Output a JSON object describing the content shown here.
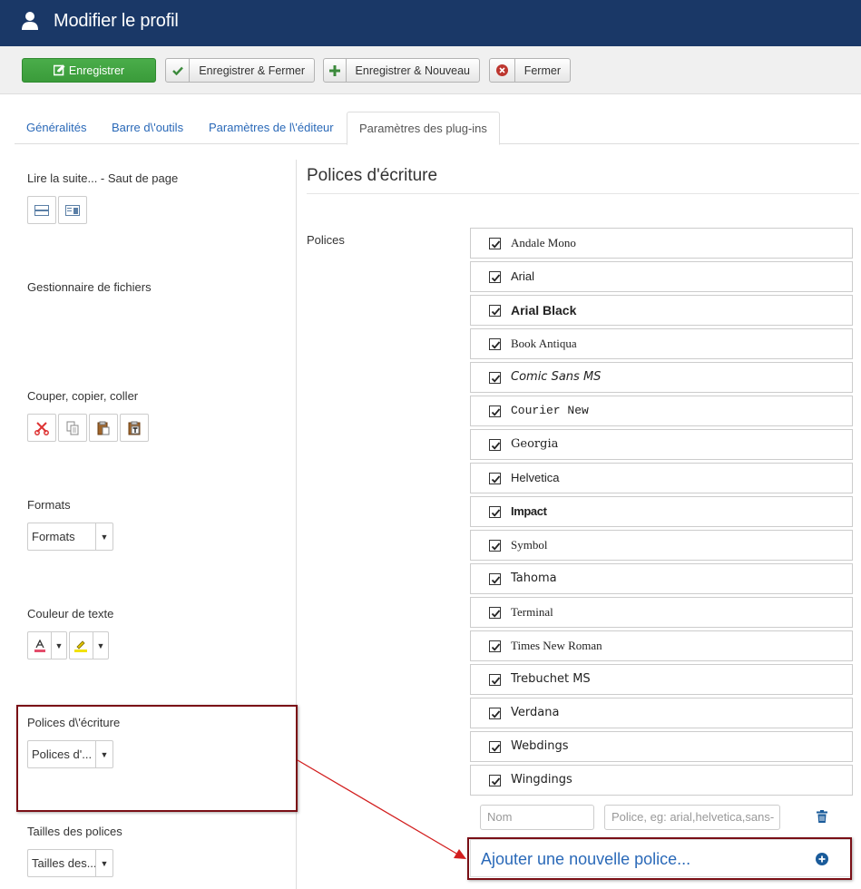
{
  "header": {
    "title": "Modifier le profil",
    "icon": "user-icon"
  },
  "toolbar": {
    "save": "Enregistrer",
    "save_close": "Enregistrer & Fermer",
    "save_new": "Enregistrer & Nouveau",
    "close": "Fermer",
    "colors": {
      "primary": "#3fa43f",
      "check": "#3c8a3c",
      "plus": "#3c8a3c",
      "close": "#bd362f"
    }
  },
  "tabs": [
    {
      "label": "Généralités",
      "active": false
    },
    {
      "label": "Barre d\\'outils",
      "active": false
    },
    {
      "label": "Paramètres de l\\'éditeur",
      "active": false
    },
    {
      "label": "Paramètres des plug-ins",
      "active": true
    }
  ],
  "left": {
    "pagebreak_label": "Lire la suite... - Saut de page",
    "filemanager_label": "Gestionnaire de fichiers",
    "clipboard_label": "Couper, copier, coller",
    "formats_label": "Formats",
    "formats_value": "Formats",
    "textcolor_label": "Couleur de texte",
    "fonts_label": "Polices d\\'écriture",
    "fonts_value": "Polices d'...",
    "fontsizes_label": "Tailles des polices",
    "fontsizes_value": "Tailles des..."
  },
  "main": {
    "section_title": "Polices d'écriture",
    "fonts_field_label": "Polices",
    "fonts": [
      {
        "name": "Andale Mono",
        "checked": true
      },
      {
        "name": "Arial",
        "checked": true
      },
      {
        "name": "Arial Black",
        "checked": true
      },
      {
        "name": "Book Antiqua",
        "checked": true
      },
      {
        "name": "Comic Sans MS",
        "checked": true
      },
      {
        "name": "Courier New",
        "checked": true
      },
      {
        "name": "Georgia",
        "checked": true
      },
      {
        "name": "Helvetica",
        "checked": true
      },
      {
        "name": "Impact",
        "checked": true
      },
      {
        "name": "Symbol",
        "checked": true
      },
      {
        "name": "Tahoma",
        "checked": true
      },
      {
        "name": "Terminal",
        "checked": true
      },
      {
        "name": "Times New Roman",
        "checked": true
      },
      {
        "name": "Trebuchet MS",
        "checked": true
      },
      {
        "name": "Verdana",
        "checked": true
      },
      {
        "name": "Webdings",
        "checked": true
      },
      {
        "name": "Wingdings",
        "checked": true
      }
    ],
    "new_font": {
      "name_placeholder": "Nom",
      "value_placeholder": "Police, eg: arial,helvetica,sans-"
    },
    "add_label": "Ajouter une nouvelle police...",
    "accent_color": "#2a69b8",
    "annotation_color": "#7a0f16"
  }
}
